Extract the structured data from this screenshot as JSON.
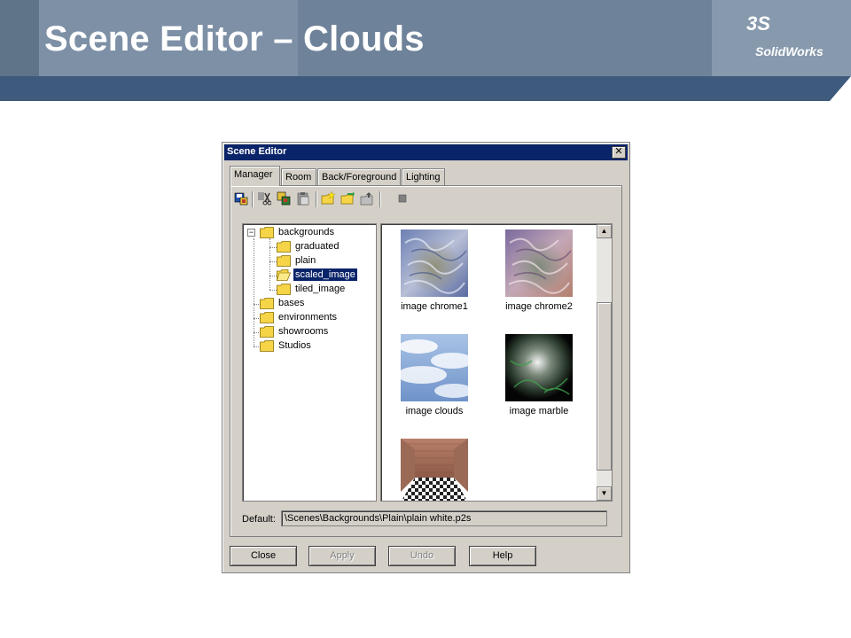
{
  "slide": {
    "title": "Scene Editor – Clouds",
    "logo_mark": "3S",
    "logo_text": "SolidWorks"
  },
  "dialog": {
    "title": "Scene Editor",
    "close_glyph": "✕",
    "tabs": [
      {
        "label": "Manager",
        "active": true
      },
      {
        "label": "Room",
        "active": false
      },
      {
        "label": "Back/Foreground",
        "active": false
      },
      {
        "label": "Lighting",
        "active": false
      }
    ],
    "toolbar_icons": [
      "save-scene-icon",
      "cut-icon",
      "copy-icon",
      "paste-icon",
      "new-folder-icon",
      "open-folder-icon",
      "folder-up-icon",
      "stop-icon"
    ],
    "tree": {
      "nodes": [
        {
          "label": "backgrounds",
          "level": 0,
          "expanded": true,
          "selected": false
        },
        {
          "label": "graduated",
          "level": 1,
          "selected": false
        },
        {
          "label": "plain",
          "level": 1,
          "selected": false
        },
        {
          "label": "scaled_image",
          "level": 1,
          "selected": true,
          "open": true
        },
        {
          "label": "tiled_image",
          "level": 1,
          "selected": false
        },
        {
          "label": "bases",
          "level": 0,
          "selected": false
        },
        {
          "label": "environments",
          "level": 0,
          "selected": false
        },
        {
          "label": "showrooms",
          "level": 0,
          "selected": false
        },
        {
          "label": "Studios",
          "level": 0,
          "selected": false
        }
      ],
      "expander_glyph": "−"
    },
    "images": [
      {
        "label": "image chrome1"
      },
      {
        "label": "image chrome2"
      },
      {
        "label": "image clouds"
      },
      {
        "label": "image marble"
      },
      {
        "label": ""
      }
    ],
    "scroll": {
      "up": "▲",
      "down": "▼"
    },
    "default_label": "Default:",
    "default_value": "\\Scenes\\Backgrounds\\Plain\\plain white.p2s",
    "buttons": [
      {
        "label": "Close",
        "enabled": true
      },
      {
        "label": "Apply",
        "enabled": false
      },
      {
        "label": "Undo",
        "enabled": false
      },
      {
        "label": "Help",
        "enabled": true
      }
    ]
  },
  "colors": {
    "title_bar": "#0a246a",
    "header_band": "#6e8299",
    "header_dark": "#3e5a7c",
    "dialog_face": "#d4d0c8"
  }
}
